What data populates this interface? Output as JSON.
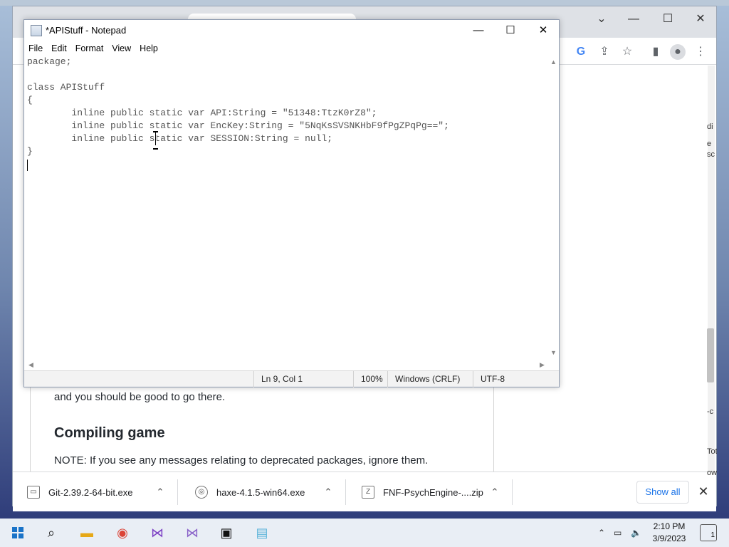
{
  "notepad": {
    "title": "*APIStuff - Notepad",
    "menu": [
      "File",
      "Edit",
      "Format",
      "View",
      "Help"
    ],
    "lines": [
      "package;",
      "",
      "class APIStuff",
      "{",
      "        inline public static var API:String = \"51348:TtzK0rZ8\";",
      "        inline public static var EncKey:String = \"5NqKsSVSNKHbF9fPgZPqPg==\";",
      "        inline public static var SESSION:String = null;",
      "}",
      ""
    ],
    "status": {
      "position": "Ln 9, Col 1",
      "zoom": "100%",
      "line_ending": "Windows (CRLF)",
      "encoding": "UTF-8"
    }
  },
  "chrome": {
    "article": {
      "line1": "and you should be good to go there.",
      "heading": "Compiling game",
      "note": "NOTE: If you see any messages relating to deprecated packages, ignore them."
    },
    "edge_text": [
      "di",
      "e",
      "sc",
      "-c",
      "Tot",
      "ow"
    ]
  },
  "downloads": {
    "items": [
      "Git-2.39.2-64-bit.exe",
      "haxe-4.1.5-win64.exe",
      "FNF-PsychEngine-....zip"
    ],
    "show_all": "Show all"
  },
  "taskbar": {
    "time": "2:10 PM",
    "date": "3/9/2023",
    "notification_count": "1"
  }
}
